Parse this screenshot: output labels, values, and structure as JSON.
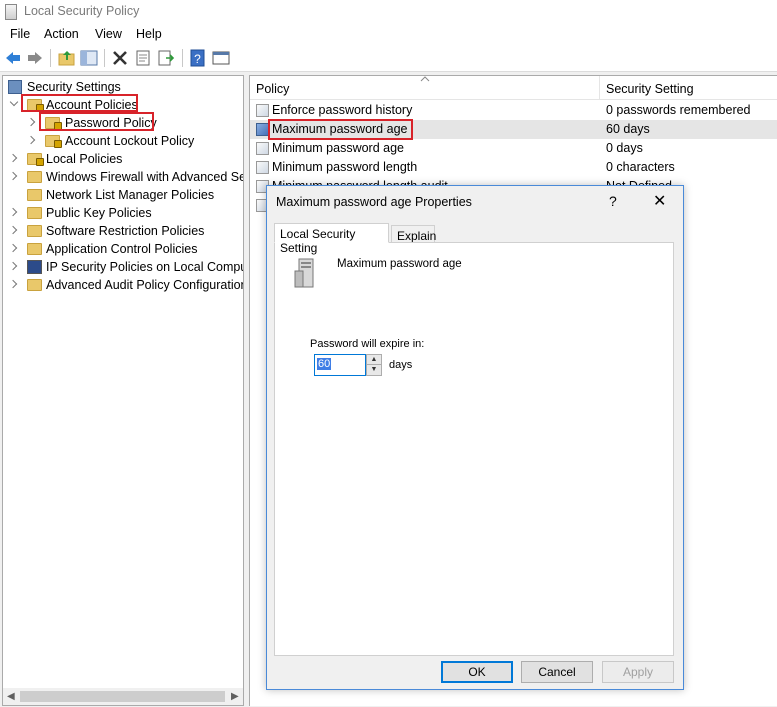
{
  "window": {
    "title": "Local Security Policy"
  },
  "menu": [
    "File",
    "Action",
    "View",
    "Help"
  ],
  "toolbar": [
    "back-arrow-icon",
    "forward-arrow-icon",
    "up-folder-icon",
    "show-hide-tree-icon",
    "delete-icon",
    "properties-icon",
    "export-list-icon",
    "help-icon",
    "console-icon"
  ],
  "tree": {
    "root": "Security Settings",
    "items": [
      {
        "label": "Account Policies"
      },
      {
        "label": "Password Policy"
      },
      {
        "label": "Account Lockout Policy"
      },
      {
        "label": "Local Policies"
      },
      {
        "label": "Windows Firewall with Advanced Security"
      },
      {
        "label": "Network List Manager Policies"
      },
      {
        "label": "Public Key Policies"
      },
      {
        "label": "Software Restriction Policies"
      },
      {
        "label": "Application Control Policies"
      },
      {
        "label": "IP Security Policies on Local Computer"
      },
      {
        "label": "Advanced Audit Policy Configuration"
      }
    ]
  },
  "list": {
    "col_policy": "Policy",
    "col_setting": "Security Setting",
    "rows": [
      {
        "policy": "Enforce password history",
        "setting": "0 passwords remembered"
      },
      {
        "policy": "Maximum password age",
        "setting": "60 days"
      },
      {
        "policy": "Minimum password age",
        "setting": "0 days"
      },
      {
        "policy": "Minimum password length",
        "setting": "0 characters"
      },
      {
        "policy": "Minimum password length audit",
        "setting": "Not Defined"
      }
    ]
  },
  "dialog": {
    "title": "Maximum password age Properties",
    "help": "?",
    "close": "✕",
    "tabs": [
      "Local Security Setting",
      "Explain"
    ],
    "policy_name": "Maximum password age",
    "expire_label": "Password will expire in:",
    "expire_value": "60",
    "unit": "days",
    "ok": "OK",
    "cancel": "Cancel",
    "apply": "Apply"
  },
  "colors": {
    "highlight_border": "#d8232a",
    "dialog_border": "#4a8ad8",
    "selection": "#3f7ee6"
  }
}
